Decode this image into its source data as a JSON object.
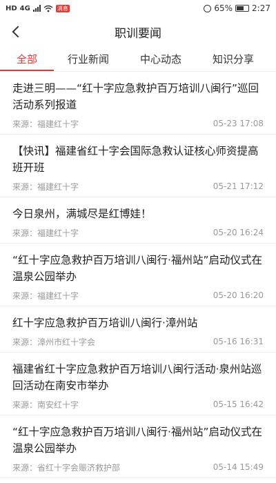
{
  "status_bar": {
    "network": "HD",
    "signal_label": "4G",
    "badge": "消息",
    "battery": "65%",
    "battery_level": 0.65,
    "time": "2:27"
  },
  "nav": {
    "title": "职训要闻",
    "back_icon": "back-arrow-icon"
  },
  "tabs": [
    {
      "label": "全部",
      "active": true
    },
    {
      "label": "行业新闻",
      "active": false
    },
    {
      "label": "中心动态",
      "active": false
    },
    {
      "label": "知识分享",
      "active": false
    }
  ],
  "accent_color": "#e53935",
  "news": [
    {
      "title": "走进三明——“红十字应急救护百万培训八闽行”巡回活动系列报道",
      "source": "来源：福建红十字",
      "date": "05-23 17:08"
    },
    {
      "title": "【快讯】福建省红十字会国际急救认证核心师资提高班开班",
      "source": "来源：福建红十字",
      "date": "05-21 17:12"
    },
    {
      "title": "今日泉州，满城尽是红博娃！",
      "source": "来源：福建红十字",
      "date": "05-20 16:24"
    },
    {
      "title": "“红十字应急救护百万培训八闽行·福州站”启动仪式在温泉公园举办",
      "source": "来源：福建红十字",
      "date": "05-20 16:20"
    },
    {
      "title": "红十字应急救护百万培训八闽行·漳州站",
      "source": "来源：漳州市红十字会",
      "date": "05-16 16:31"
    },
    {
      "title": "福建省红十字应急救护百万培训八闽行活动·泉州站巡回活动在南安市举办",
      "source": "来源：南安红十字",
      "date": "05-15 16:42"
    },
    {
      "title": "“红十字应急救护百万培训八闽行·福州站”启动仪式在温泉公园举办",
      "source": "来源：省红十字会赈济救护部",
      "date": "05-14 15:49"
    }
  ]
}
